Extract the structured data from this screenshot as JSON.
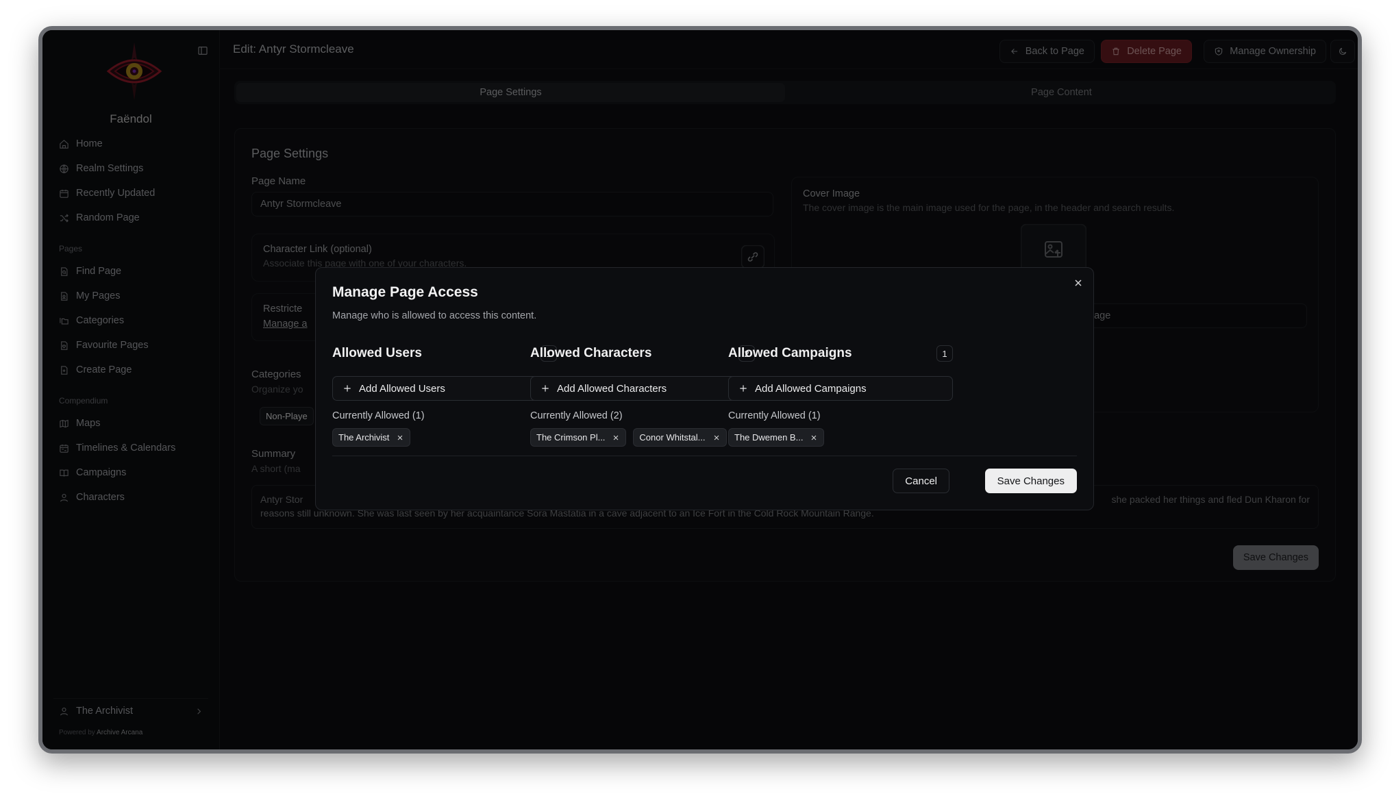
{
  "sidebar": {
    "realm_name": "Faëndol",
    "main_items": [
      {
        "label": "Home",
        "icon": "home-icon"
      },
      {
        "label": "Realm Settings",
        "icon": "globe-gear-icon"
      },
      {
        "label": "Recently Updated",
        "icon": "calendar-icon"
      },
      {
        "label": "Random Page",
        "icon": "shuffle-icon"
      }
    ],
    "pages_section": "Pages",
    "pages_items": [
      {
        "label": "Find Page",
        "icon": "file-search-icon"
      },
      {
        "label": "My Pages",
        "icon": "file-user-icon"
      },
      {
        "label": "Categories",
        "icon": "folders-icon"
      },
      {
        "label": "Favourite Pages",
        "icon": "file-heart-icon"
      },
      {
        "label": "Create Page",
        "icon": "file-plus-icon"
      }
    ],
    "compendium_section": "Compendium",
    "compendium_items": [
      {
        "label": "Maps",
        "icon": "map-icon"
      },
      {
        "label": "Timelines & Calendars",
        "icon": "calendar-range-icon"
      },
      {
        "label": "Campaigns",
        "icon": "book-open-icon"
      },
      {
        "label": "Characters",
        "icon": "user-icon"
      }
    ],
    "user": "The Archivist",
    "powered_prefix": "Powered by",
    "powered_brand": "Archive Arcana"
  },
  "header": {
    "title": "Edit: Antyr Stormcleave",
    "back": "Back to Page",
    "delete": "Delete Page",
    "ownership": "Manage Ownership"
  },
  "tabs": [
    "Page Settings",
    "Page Content"
  ],
  "settings": {
    "title": "Page Settings",
    "page_name_label": "Page Name",
    "page_name_value": "Antyr Stormcleave",
    "char_link_label": "Character Link (optional)",
    "char_link_sub": "Associate this page with one of your characters.",
    "restricted_label": "Restricte",
    "restricted_link": "Manage a",
    "categories_label": "Categories",
    "categories_sub": "Organize yo",
    "category_chip": "Non-Playe",
    "summary_label": "Summary",
    "summary_sub": "A short (ma",
    "summary_line1_start": "Antyr Stor",
    "summary_line1_end": "she packed her things and fled Dun Kharon for",
    "summary_line2": "reasons still unknown. She was last seen by her acquaintance Sora Mastatia in a cave adjacent to an Ice Fort in the Cold Rock Mountain Range.",
    "cover_label": "Cover Image",
    "cover_sub": "The cover image is the main image used for the page, in the header and search results.",
    "cover_input_tail": "nage",
    "save": "Save Changes"
  },
  "modal": {
    "title": "Manage Page Access",
    "subtitle": "Manage who is allowed to access this content.",
    "columns": [
      {
        "title": "Allowed Users",
        "count": "1",
        "add": "Add Allowed Users",
        "current": "Currently Allowed (1)",
        "chips": [
          "The Archivist"
        ]
      },
      {
        "title": "Allowed Characters",
        "count": "2",
        "add": "Add Allowed Characters",
        "current": "Currently Allowed (2)",
        "chips": [
          "The Crimson Pl...",
          "Conor Whitstal..."
        ]
      },
      {
        "title": "Allowed Campaigns",
        "count": "1",
        "add": "Add Allowed Campaigns",
        "current": "Currently Allowed (1)",
        "chips": [
          "The Dwemen B..."
        ]
      }
    ],
    "cancel": "Cancel",
    "save": "Save Changes"
  },
  "colors": {
    "background": "#0c0d10",
    "danger": "#6a1d22",
    "primary_button": "#eeeeef",
    "logo_accent": "#9b1c2c"
  }
}
